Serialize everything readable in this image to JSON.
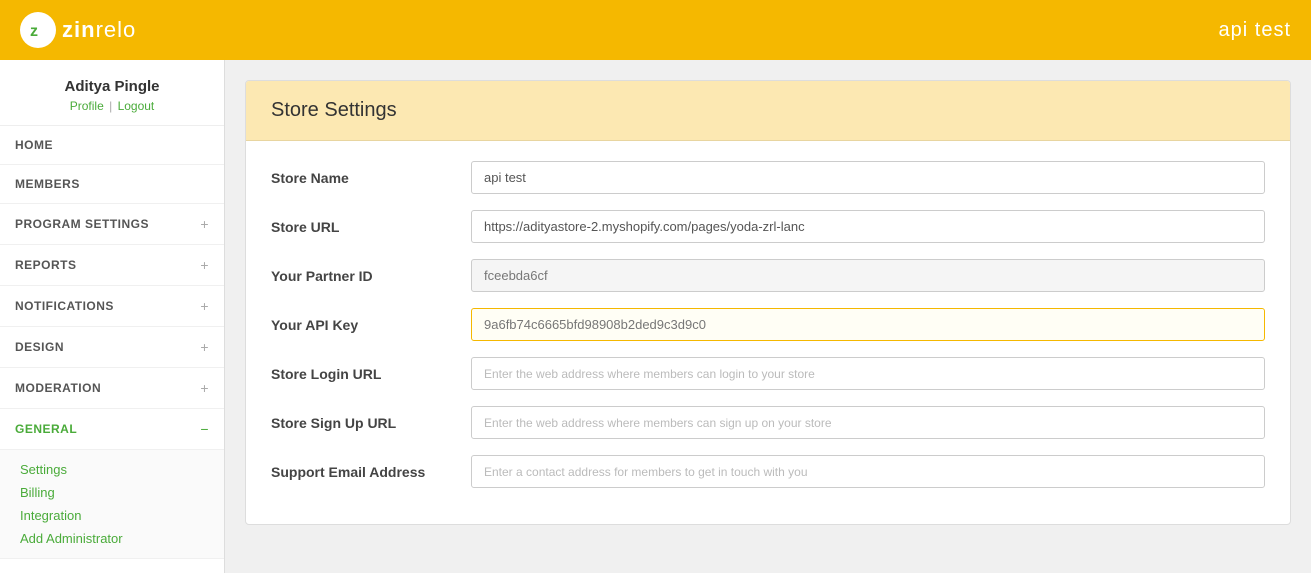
{
  "header": {
    "app_name": "api test",
    "logo_letter": "z",
    "logo_full": "zinrelo"
  },
  "sidebar": {
    "user": {
      "name": "Aditya Pingle",
      "profile_label": "Profile",
      "logout_label": "Logout"
    },
    "nav_items": [
      {
        "id": "home",
        "label": "HOME",
        "has_children": false,
        "active": false
      },
      {
        "id": "members",
        "label": "MEMBERS",
        "has_children": false,
        "active": false
      },
      {
        "id": "program-settings",
        "label": "PROGRAM SETTINGS",
        "has_children": true,
        "active": false
      },
      {
        "id": "reports",
        "label": "REPORTS",
        "has_children": true,
        "active": false
      },
      {
        "id": "notifications",
        "label": "NOTIFICATIONS",
        "has_children": true,
        "active": false
      },
      {
        "id": "design",
        "label": "DESIGN",
        "has_children": true,
        "active": false
      },
      {
        "id": "moderation",
        "label": "MODERATION",
        "has_children": true,
        "active": false
      },
      {
        "id": "general",
        "label": "GENERAL",
        "has_children": true,
        "active": true,
        "expanded": true
      }
    ],
    "general_sub_items": [
      {
        "label": "Settings",
        "href": "#"
      },
      {
        "label": "Billing",
        "href": "#"
      },
      {
        "label": "Integration",
        "href": "#"
      },
      {
        "label": "Add Administrator",
        "href": "#"
      }
    ]
  },
  "main": {
    "card_title": "Store Settings",
    "fields": [
      {
        "id": "store-name",
        "label": "Store Name",
        "value": "api test",
        "placeholder": "",
        "readonly": false,
        "highlight": false
      },
      {
        "id": "store-url",
        "label": "Store URL",
        "value": "https://adityastore-2.myshopify.com/pages/yoda-zrl-lanc",
        "placeholder": "",
        "readonly": false,
        "highlight": false
      },
      {
        "id": "partner-id",
        "label": "Your Partner ID",
        "value": "fceebda6cf",
        "placeholder": "",
        "readonly": true,
        "highlight": false
      },
      {
        "id": "api-key",
        "label": "Your API Key",
        "value": "9a6fb74c6665bfd98908b2ded9c3d9c0",
        "placeholder": "",
        "readonly": true,
        "highlight": true
      },
      {
        "id": "store-login-url",
        "label": "Store Login URL",
        "value": "",
        "placeholder": "Enter the web address where members can login to your store",
        "readonly": false,
        "highlight": false
      },
      {
        "id": "store-signup-url",
        "label": "Store Sign Up URL",
        "value": "",
        "placeholder": "Enter the web address where members can sign up on your store",
        "readonly": false,
        "highlight": false
      },
      {
        "id": "support-email",
        "label": "Support Email Address",
        "value": "",
        "placeholder": "Enter a contact address for members to get in touch with you",
        "readonly": false,
        "highlight": false
      }
    ]
  }
}
